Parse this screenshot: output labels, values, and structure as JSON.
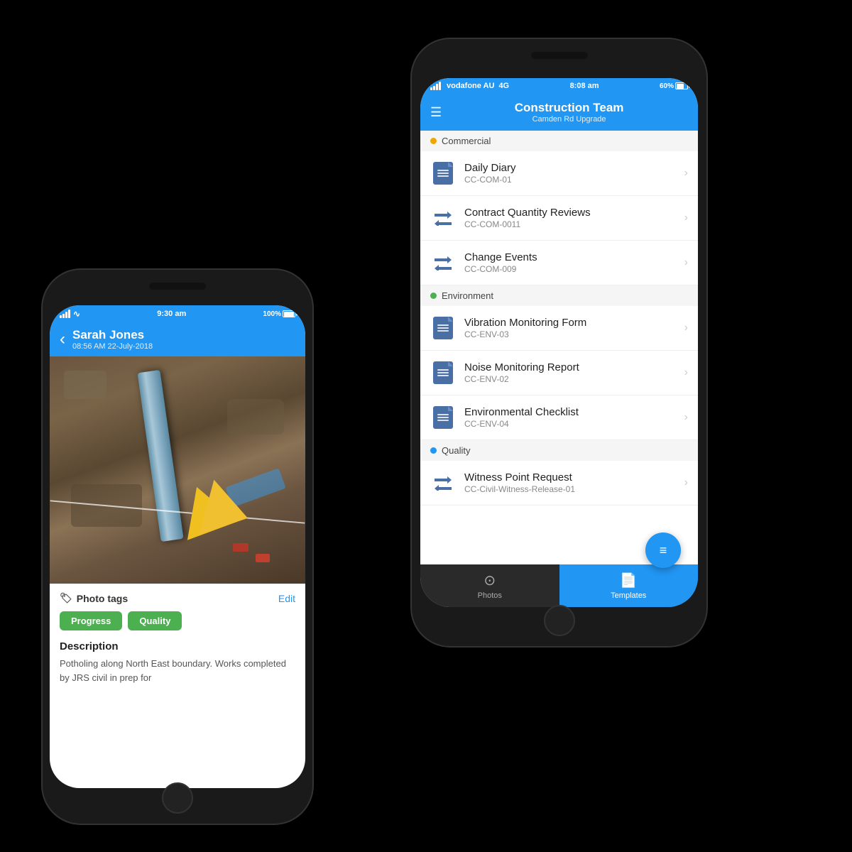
{
  "left_phone": {
    "status_bar": {
      "signal": "signal",
      "wifi": "wifi",
      "time": "9:30 am",
      "battery": "100%"
    },
    "header": {
      "back_label": "‹",
      "user_name": "Sarah Jones",
      "timestamp": "08:56 AM 22-July-2018"
    },
    "photo_tags": {
      "label": "Photo tags",
      "edit_label": "Edit",
      "tags": [
        "Progress",
        "Quality"
      ]
    },
    "description": {
      "title": "Description",
      "text": "Potholing along North East boundary. Works completed by JRS civil in prep for"
    }
  },
  "right_phone": {
    "status_bar": {
      "carrier": "vodafone AU",
      "network": "4G",
      "time": "8:08 am",
      "battery": "60%"
    },
    "header": {
      "menu_label": "☰",
      "title": "Construction Team",
      "subtitle": "Camden Rd Upgrade"
    },
    "sections": [
      {
        "id": "commercial",
        "dot_color": "#f0a500",
        "label": "Commercial",
        "items": [
          {
            "icon": "doc",
            "title": "Daily Diary",
            "sub": "CC-COM-01"
          },
          {
            "icon": "exchange",
            "title": "Contract Quantity Reviews",
            "sub": "CC-COM-0011"
          },
          {
            "icon": "exchange",
            "title": "Change Events",
            "sub": "CC-COM-009"
          }
        ]
      },
      {
        "id": "environment",
        "dot_color": "#4CAF50",
        "label": "Environment",
        "items": [
          {
            "icon": "doc",
            "title": "Vibration Monitoring Form",
            "sub": "CC-ENV-03"
          },
          {
            "icon": "doc",
            "title": "Noise Monitoring Report",
            "sub": "CC-ENV-02"
          },
          {
            "icon": "doc",
            "title": "Environmental Checklist",
            "sub": "CC-ENV-04"
          }
        ]
      },
      {
        "id": "quality",
        "dot_color": "#2196F3",
        "label": "Quality",
        "items": [
          {
            "icon": "exchange",
            "title": "Witness Point Request",
            "sub": "CC-Civil-Witness-Release-01"
          }
        ]
      }
    ],
    "bottom_nav": {
      "photos_label": "Photos",
      "templates_label": "Templates"
    },
    "fab_label": "≡"
  }
}
